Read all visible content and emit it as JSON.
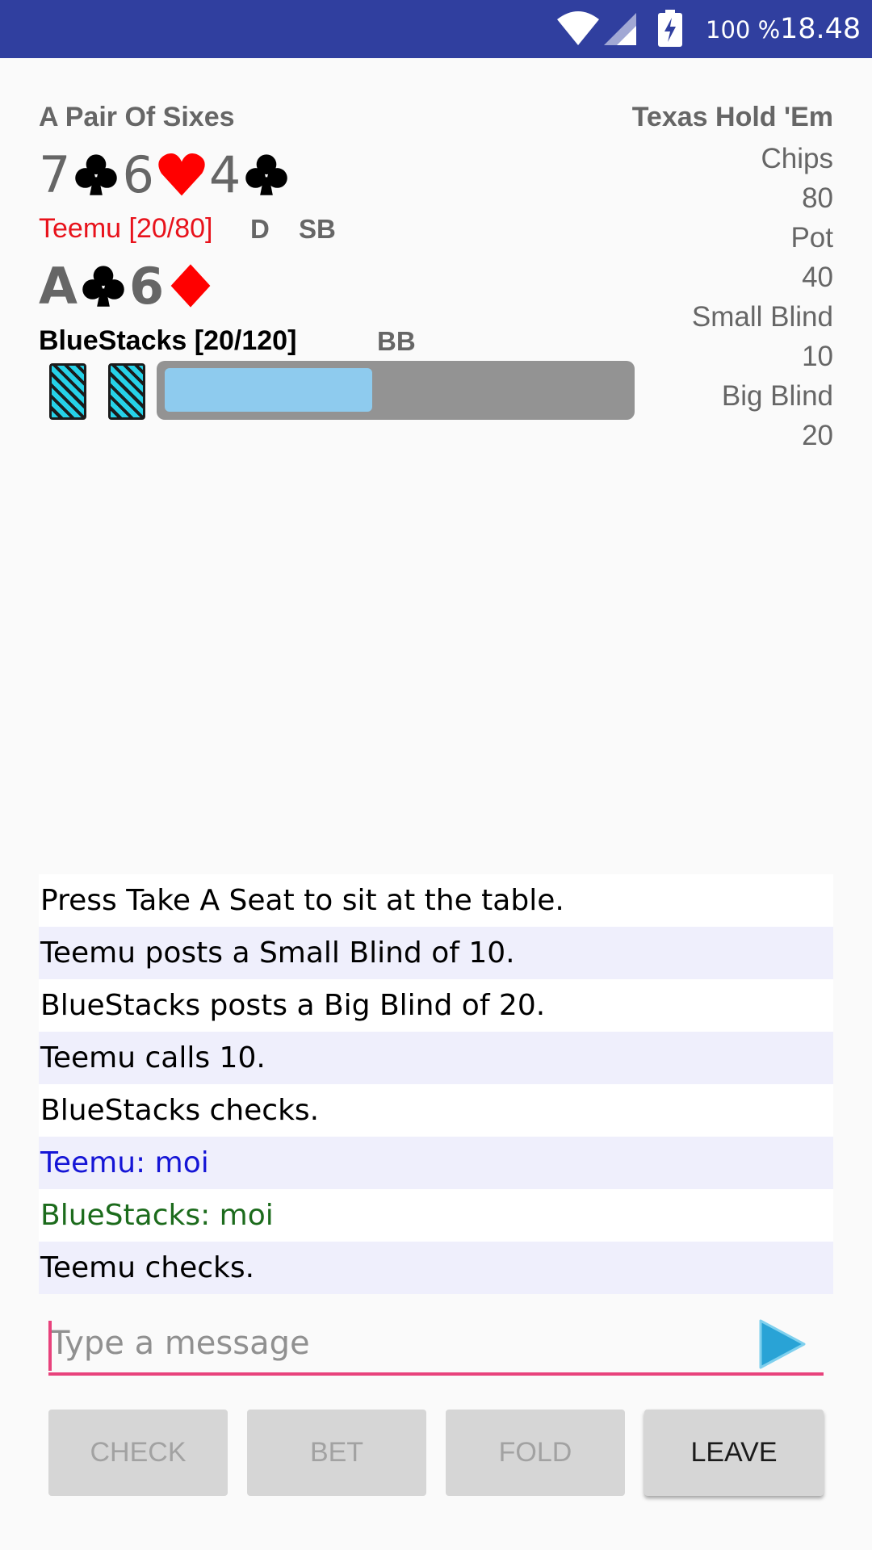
{
  "status_bar": {
    "battery_percent": "100 %",
    "time": "18.48"
  },
  "hand_name": "A Pair Of Sixes",
  "game_type": "Texas Hold 'Em",
  "table_info": [
    {
      "label": "Chips",
      "value": "80"
    },
    {
      "label": "Pot",
      "value": "40"
    },
    {
      "label": "Small Blind",
      "value": "10"
    },
    {
      "label": "Big Blind",
      "value": "20"
    }
  ],
  "community_cards": [
    {
      "rank": "7",
      "suit": "club-icon"
    },
    {
      "rank": "6",
      "suit": "heart-icon"
    },
    {
      "rank": "4",
      "suit": "club-icon"
    }
  ],
  "player1": {
    "name": "Teemu [20/80]",
    "dealer_tag": "D",
    "blind_tag": "SB",
    "color": "#e8121b"
  },
  "hole_cards": [
    {
      "rank": "A",
      "suit": "club-icon"
    },
    {
      "rank": "6",
      "suit": "diamond-icon"
    }
  ],
  "player2": {
    "name": "BlueStacks [20/120]",
    "blind_tag": "BB",
    "timer_fraction": 0.45
  },
  "log": [
    {
      "text": "Press Take A Seat to sit at the table.",
      "color": "#000000"
    },
    {
      "text": "Teemu posts a Small Blind of 10.",
      "color": "#000000"
    },
    {
      "text": "BlueStacks posts a Big Blind of 20.",
      "color": "#000000"
    },
    {
      "text": "Teemu calls 10.",
      "color": "#000000"
    },
    {
      "text": "BlueStacks checks.",
      "color": "#000000"
    },
    {
      "text": "Teemu:  moi",
      "color": "#1515d6"
    },
    {
      "text": "BlueStacks:  moi",
      "color": "#1c6b1c"
    },
    {
      "text": "Teemu checks.",
      "color": "#000000"
    }
  ],
  "message": {
    "placeholder": "Type a message",
    "value": ""
  },
  "buttons": {
    "check": "CHECK",
    "bet": "BET",
    "fold": "FOLD",
    "leave": "LEAVE"
  },
  "colors": {
    "status_bar": "#303f9f",
    "accent": "#e8427c",
    "send": "#29a3d6",
    "card_red": "#ff0000"
  }
}
